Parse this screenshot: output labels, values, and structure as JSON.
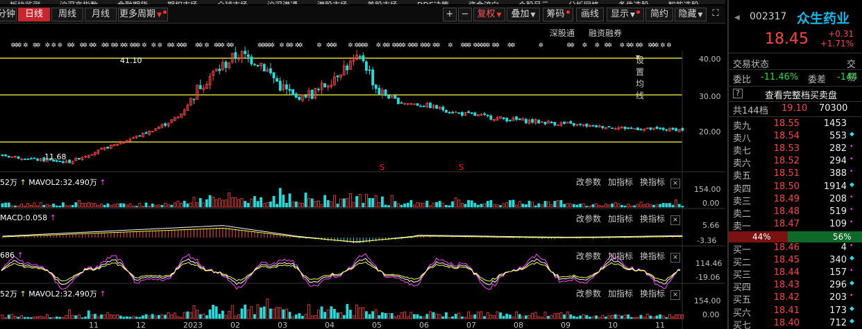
{
  "top_menu": [
    "板块监测",
    "沪深京指数",
    "金融期货",
    "期权市场",
    "全球市场",
    "沪深港通",
    "港股市场",
    "美股市场",
    "DDE决策",
    "资金流向",
    "个股风云",
    "分析网格",
    "条件选股",
    "智能选股",
    "机构调查",
    "焦点追击"
  ],
  "toolbar": {
    "periods": [
      "分钟",
      "日线",
      "周线",
      "月线",
      "更多周期"
    ],
    "active_period": "日线",
    "plus": "+",
    "minus": "−",
    "fuquan": "复权",
    "diejia": "叠加",
    "chouma": "筹码",
    "huaxian": "画线",
    "xianshi": "显示",
    "jianyue": "简约",
    "yincang": "隐藏"
  },
  "subbar": {
    "shengu": "深股通",
    "rongzi": "融资融券",
    "setma": "设置均线"
  },
  "colors": {
    "up": "#ff4444",
    "down": "#22dddd",
    "level_line": "#ffff44",
    "accent": "#c9252c",
    "name": "#12b8e8"
  },
  "main_chart": {
    "y_ticks": [
      "40.00",
      "30.00",
      "20.00"
    ],
    "high_label": "41.10",
    "low_label": "11.68",
    "s_marks": [
      "S",
      "S"
    ]
  },
  "volume_panel": {
    "title_prefix": "52万",
    "title_ma": "MAVOL2:32.490万",
    "y_ticks": [
      "154.00",
      "0.00"
    ]
  },
  "macd_panel": {
    "title": "MACD:0.058",
    "y_ticks": [
      "5.66",
      "-3.36"
    ]
  },
  "kdj_panel": {
    "title": "686",
    "y_ticks": [
      "114.46",
      "-19.06"
    ]
  },
  "volume2_panel": {
    "title_prefix": "52万",
    "title_ma": "MAVOL2:32.490万",
    "y_ticks": [
      "154.00",
      "0.00"
    ]
  },
  "panel_controls": {
    "gaicanshu": "改参数",
    "jiazhibiao": "加指标",
    "huanzhibiao": "换指标",
    "close": "×"
  },
  "x_ticks": [
    "11",
    "12",
    "2023",
    "02",
    "03",
    "04",
    "05",
    "06",
    "07",
    "08",
    "09",
    "10",
    "11"
  ],
  "stock": {
    "code": "002317",
    "name": "众生药业",
    "price": "18.45",
    "change": "+0.31",
    "change_pct": "+1.71%",
    "trade_status_label": "交易状态",
    "trade_status_value": "交易",
    "weibi_label": "委比",
    "weibi": "-11.46%",
    "weicha_label": "委差",
    "weicha": "-144",
    "full_book": "查看完整档买卖盘",
    "help": "?",
    "total_levels": "共144档",
    "total_price": "19.10",
    "total_vol": "70300",
    "sell_pct": "44%",
    "buy_pct": "56%"
  },
  "sells": [
    {
      "label": "卖九",
      "price": "18.55",
      "vol": "1453",
      "mark": ""
    },
    {
      "label": "卖八",
      "price": "18.54",
      "vol": "553",
      "mark": "◆"
    },
    {
      "label": "卖七",
      "price": "18.53",
      "vol": "282",
      "mark": "•"
    },
    {
      "label": "卖六",
      "price": "18.52",
      "vol": "294",
      "mark": "•"
    },
    {
      "label": "卖五",
      "price": "18.51",
      "vol": "388",
      "mark": "•"
    },
    {
      "label": "卖四",
      "price": "18.50",
      "vol": "1914",
      "mark": "◆"
    },
    {
      "label": "卖三",
      "price": "18.49",
      "vol": "208",
      "mark": "•"
    },
    {
      "label": "卖二",
      "price": "18.48",
      "vol": "519",
      "mark": "•"
    },
    {
      "label": "卖一",
      "price": "18.47",
      "vol": "109",
      "mark": "•"
    }
  ],
  "buys": [
    {
      "label": "买一",
      "price": "18.46",
      "vol": "4",
      "mark": "•"
    },
    {
      "label": "买二",
      "price": "18.45",
      "vol": "340",
      "mark": "◆"
    },
    {
      "label": "买三",
      "price": "18.44",
      "vol": "157",
      "mark": "•"
    },
    {
      "label": "买四",
      "price": "18.43",
      "vol": "296",
      "mark": "◆"
    },
    {
      "label": "买五",
      "price": "18.42",
      "vol": "203",
      "mark": "•"
    },
    {
      "label": "买六",
      "price": "18.41",
      "vol": "173",
      "mark": "◆"
    },
    {
      "label": "买七",
      "price": "18.40",
      "vol": "712",
      "mark": "◆"
    }
  ]
}
